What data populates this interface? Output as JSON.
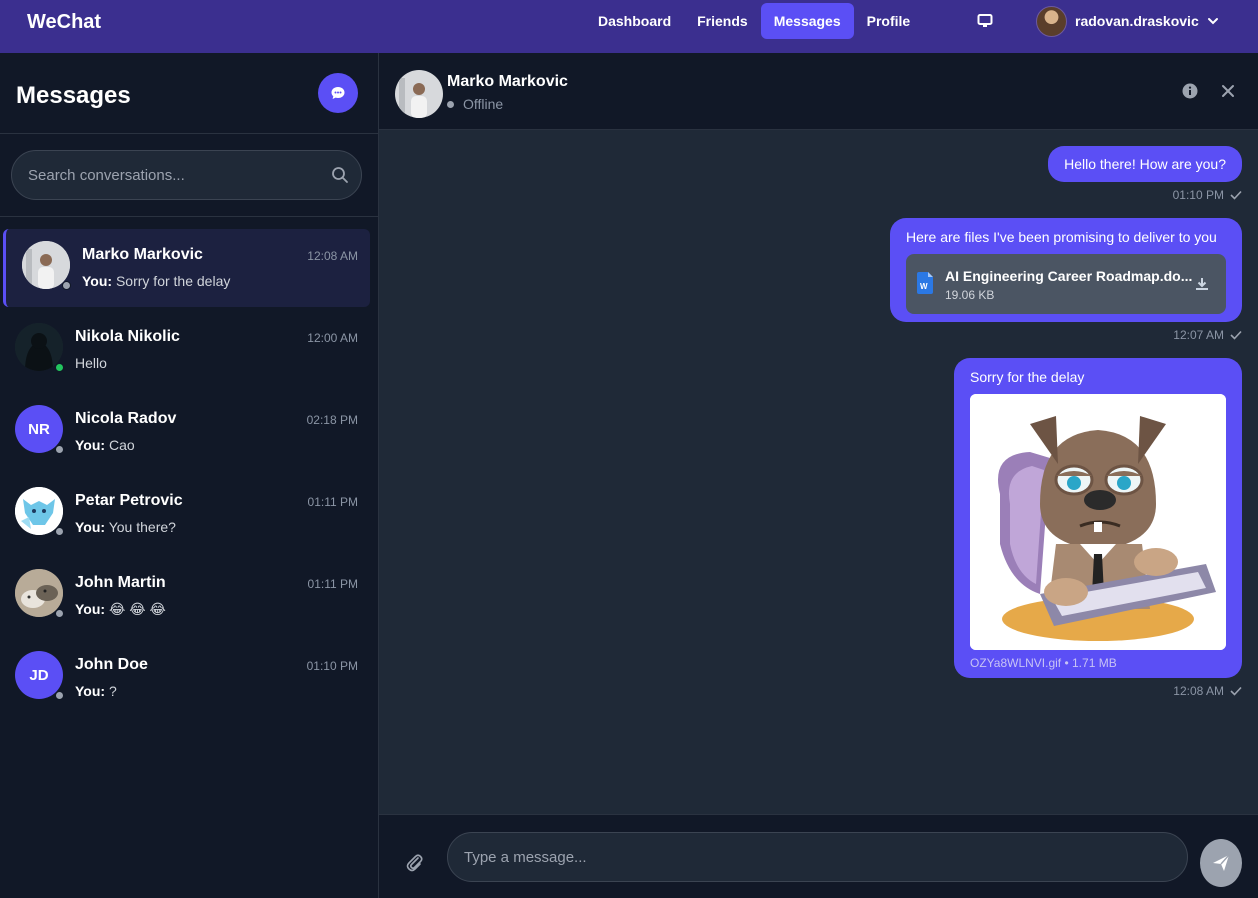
{
  "app": {
    "brand": "WeChat"
  },
  "nav": {
    "links": [
      "Dashboard",
      "Friends",
      "Messages",
      "Profile"
    ],
    "active": "Messages",
    "username": "radovan.draskovic"
  },
  "sidebar": {
    "title": "Messages",
    "search_placeholder": "Search conversations...",
    "conversations": [
      {
        "name": "Marko Markovic",
        "time": "12:08 AM",
        "prefix": "You:",
        "preview": "Sorry for the delay",
        "status": "offline",
        "active": true
      },
      {
        "name": "Nikola Nikolic",
        "time": "12:00 AM",
        "prefix": "",
        "preview": "Hello",
        "status": "online"
      },
      {
        "name": "Nicola Radov",
        "time": "02:18 PM",
        "prefix": "You:",
        "preview": "Cao",
        "status": "offline",
        "initials": "NR"
      },
      {
        "name": "Petar Petrovic",
        "time": "01:11 PM",
        "prefix": "You:",
        "preview": "You there?",
        "status": "offline"
      },
      {
        "name": "John Martin",
        "time": "01:11 PM",
        "prefix": "You:",
        "preview": "😂 😂 😂",
        "status": "offline"
      },
      {
        "name": "John Doe",
        "time": "01:10 PM",
        "prefix": "You:",
        "preview": "?",
        "status": "offline",
        "initials": "JD"
      }
    ]
  },
  "chat": {
    "contact_name": "Marko Markovic",
    "contact_status": "Offline",
    "messages": [
      {
        "text": "Hello there! How are you?",
        "time": "01:10 PM"
      },
      {
        "text": "Here are files I've been promising to deliver to you",
        "file_name": "AI Engineering Career Roadmap.do...",
        "file_size": "19.06 KB",
        "time": "12:07 AM"
      },
      {
        "text": "Sorry for the delay",
        "image_caption": "OZYa8WLNVI.gif • 1.71 MB",
        "time": "12:08 AM"
      }
    ],
    "input_placeholder": "Type a message..."
  },
  "colors": {
    "nav_bg": "#3b2f8f",
    "accent": "#5b4ff5",
    "online": "#22c55e",
    "offline": "#9ca3af"
  }
}
